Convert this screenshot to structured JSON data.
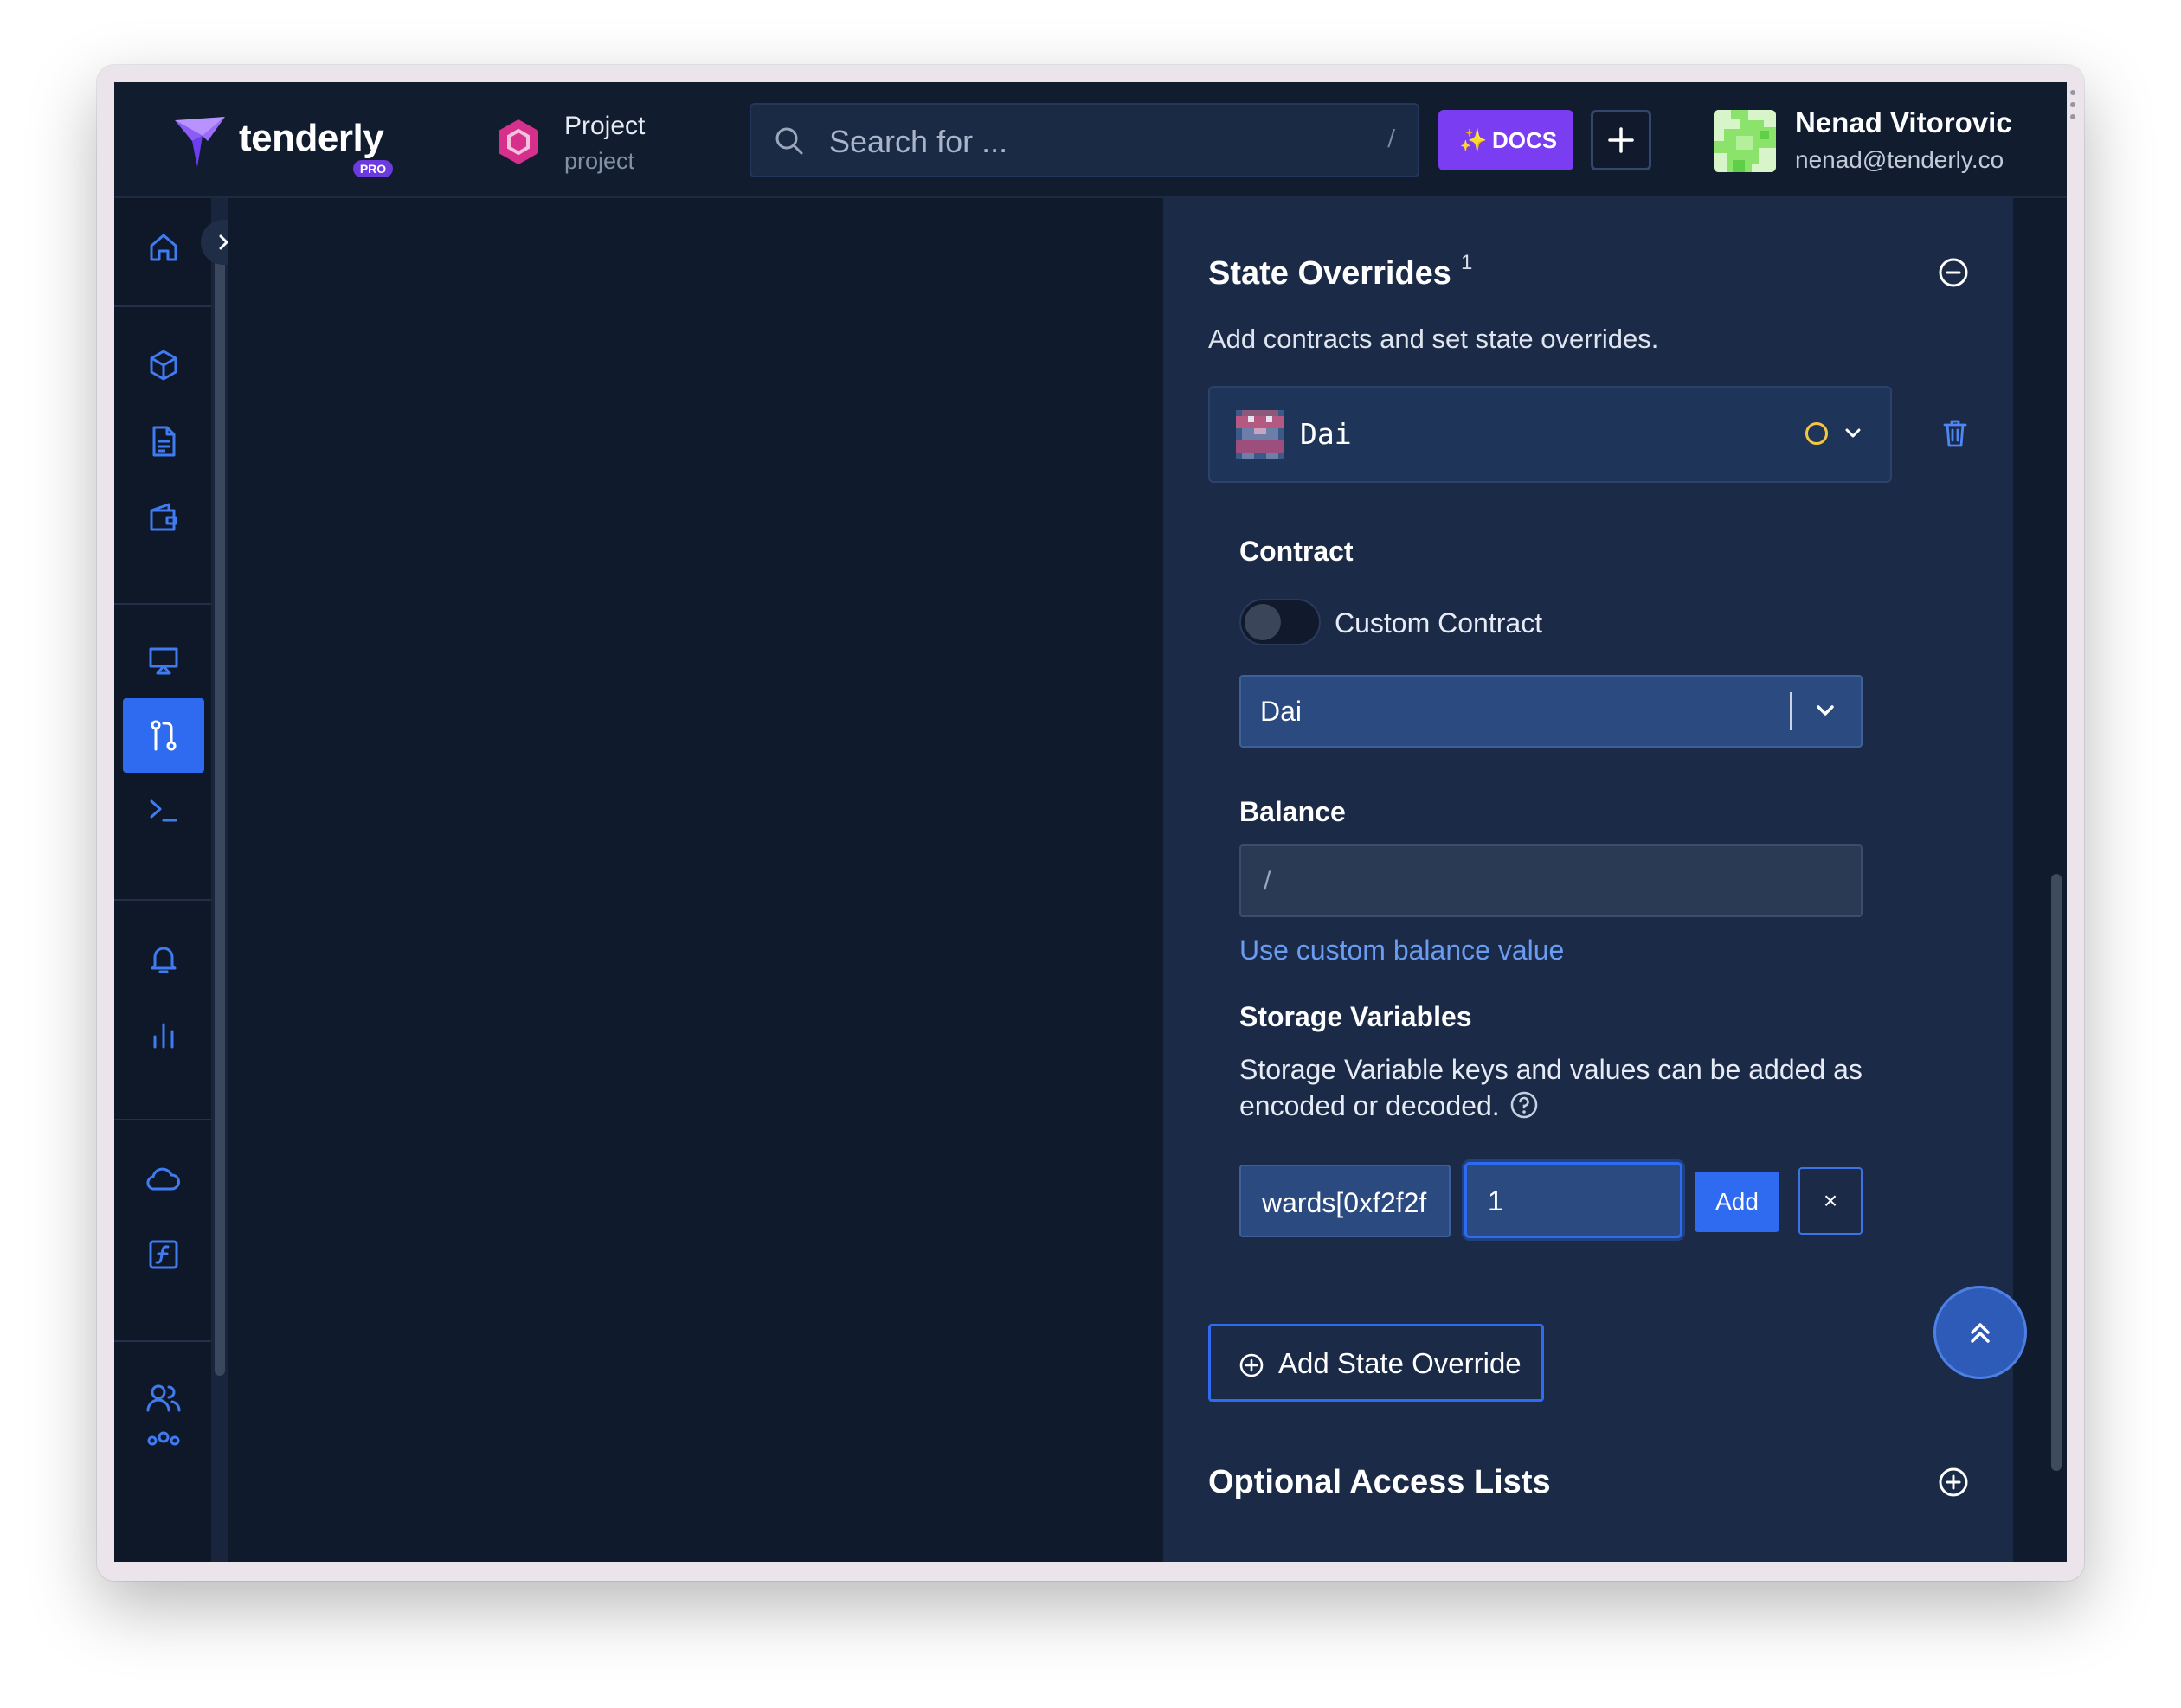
{
  "header": {
    "logo_text": "tenderly",
    "logo_badge": "PRO",
    "project_name": "Project",
    "project_slug": "project",
    "search_placeholder": "Search for ...",
    "search_shortcut": "/",
    "docs_label": "DOCS",
    "user_name": "Nenad Vitorovic",
    "user_email": "nenad@tenderly.co"
  },
  "sidebar": {
    "items": [
      {
        "icon": "home-icon"
      },
      {
        "icon": "cube-icon"
      },
      {
        "icon": "document-icon"
      },
      {
        "icon": "wallet-icon"
      },
      {
        "icon": "presentation-icon"
      },
      {
        "icon": "git-branch-icon",
        "active": true
      },
      {
        "icon": "terminal-icon"
      },
      {
        "icon": "bell-icon"
      },
      {
        "icon": "bar-chart-icon"
      },
      {
        "icon": "cloud-icon"
      },
      {
        "icon": "function-icon"
      },
      {
        "icon": "users-icon"
      },
      {
        "icon": "team-icon"
      }
    ]
  },
  "state_overrides": {
    "title": "State Overrides",
    "count": "1",
    "description": "Add contracts and set state overrides.",
    "contract_card": {
      "name": "Dai",
      "status_color": "#f2c744"
    },
    "contract_label": "Contract",
    "custom_contract_label": "Custom Contract",
    "custom_contract_enabled": false,
    "contract_select_value": "Dai",
    "balance_label": "Balance",
    "balance_placeholder": "/",
    "custom_balance_link": "Use custom balance value",
    "storage_label": "Storage Variables",
    "storage_description_line1": "Storage Variable keys and values can be added as",
    "storage_description_line2": "encoded or decoded.",
    "storage_key_value": "wards[0xf2f2f",
    "storage_value_value": "1",
    "add_label": "Add",
    "remove_label": "×",
    "add_override_label": "Add State Override"
  },
  "access_lists": {
    "title": "Optional Access Lists"
  },
  "colors": {
    "accent": "#2f6bf0",
    "docs_purple": "#7a3df2",
    "panel_bg": "#1a2a47",
    "app_bg": "#101a2c"
  }
}
